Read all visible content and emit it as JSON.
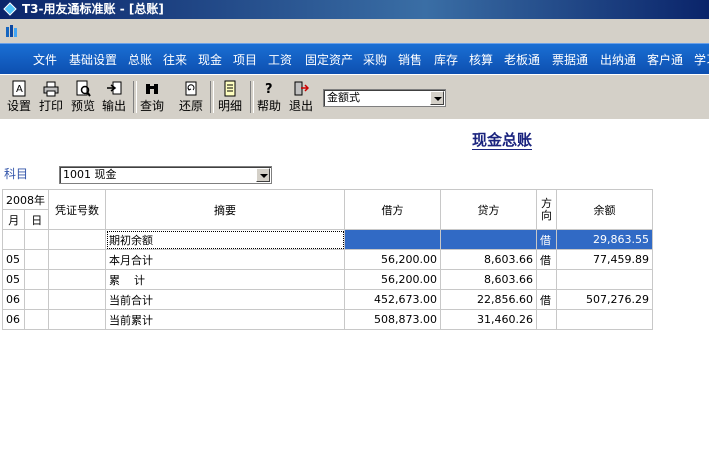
{
  "window": {
    "title": "T3-用友通标准账 - [总账]"
  },
  "menu": [
    "文件",
    "基础设置",
    "总账",
    "往来",
    "现金",
    "项目",
    "工资",
    "固定资产",
    "采购",
    "销售",
    "库存",
    "核算",
    "老板通",
    "票据通",
    "出纳通",
    "客户通",
    "学习"
  ],
  "toolbar": {
    "buttons": [
      "设置",
      "打印",
      "预览",
      "输出",
      "查询",
      "还原",
      "明细",
      "帮助",
      "退出"
    ],
    "format_select": "金额式"
  },
  "report": {
    "title": "现金总账",
    "subject_label": "科目",
    "subject_value": "1001 现金"
  },
  "table": {
    "year_header": "2008年",
    "month_header": "月",
    "day_header": "日",
    "voucher_header": "凭证号数",
    "summary_header": "摘要",
    "debit_header": "借方",
    "credit_header": "贷方",
    "direction_header": "方向",
    "balance_header": "余额",
    "rows": [
      {
        "month": "",
        "day": "",
        "voucher": "",
        "summary": "期初余额",
        "debit": "",
        "credit": "",
        "direction": "借",
        "balance": "29,863.55"
      },
      {
        "month": "05",
        "day": "",
        "voucher": "",
        "summary": "本月合计",
        "debit": "56,200.00",
        "credit": "8,603.66",
        "direction": "借",
        "balance": "77,459.89"
      },
      {
        "month": "05",
        "day": "",
        "voucher": "",
        "summary": "累    计",
        "debit": "56,200.00",
        "credit": "8,603.66",
        "direction": "",
        "balance": ""
      },
      {
        "month": "06",
        "day": "",
        "voucher": "",
        "summary": "当前合计",
        "debit": "452,673.00",
        "credit": "22,856.60",
        "direction": "借",
        "balance": "507,276.29"
      },
      {
        "month": "06",
        "day": "",
        "voucher": "",
        "summary": "当前累计",
        "debit": "508,873.00",
        "credit": "31,460.26",
        "direction": "",
        "balance": ""
      }
    ]
  }
}
